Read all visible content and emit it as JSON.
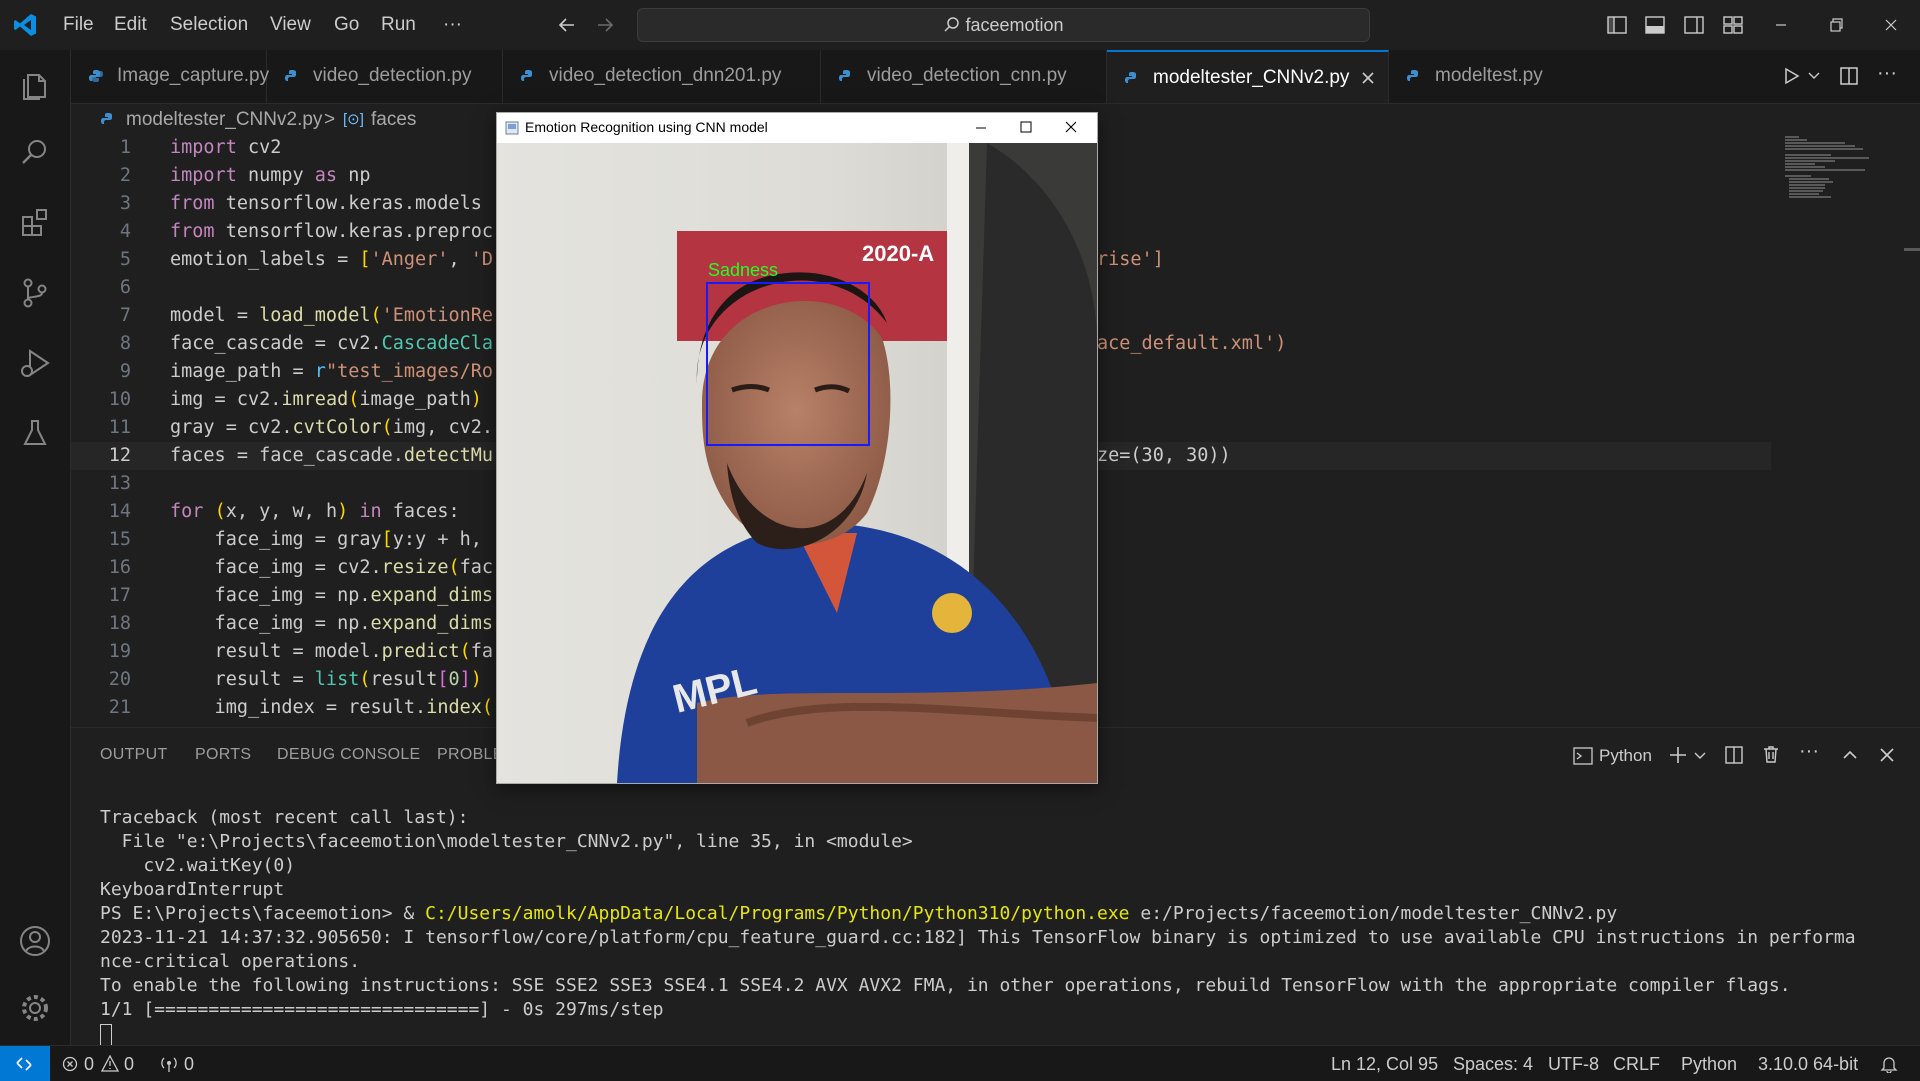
{
  "menu": [
    "File",
    "Edit",
    "Selection",
    "View",
    "Go",
    "Run",
    "···"
  ],
  "search": {
    "label": "faceemotion"
  },
  "tabs": [
    {
      "label": "Image_capture.py"
    },
    {
      "label": "video_detection.py"
    },
    {
      "label": "video_detection_dnn201.py"
    },
    {
      "label": "video_detection_cnn.py"
    },
    {
      "label": "modeltester_CNNv2.py",
      "active": true
    },
    {
      "label": "modeltest.py"
    }
  ],
  "breadcrumb": {
    "file": "modeltester_CNNv2.py",
    "separator": ">",
    "symbol": "faces"
  },
  "code_lines": [
    {
      "n": "1",
      "t": "import cv2"
    },
    {
      "n": "2",
      "t": "import numpy as np"
    },
    {
      "n": "3",
      "t": "from tensorflow.keras.models"
    },
    {
      "n": "4",
      "t": "from tensorflow.keras.preproc"
    },
    {
      "n": "5",
      "t": "emotion_labels = ['Anger', 'D"
    },
    {
      "n": "6",
      "t": ""
    },
    {
      "n": "7",
      "t": "model = load_model('EmotionRe"
    },
    {
      "n": "8",
      "t": "face_cascade = cv2.CascadeCla"
    },
    {
      "n": "9",
      "t": "image_path = r\"test_images/Ro"
    },
    {
      "n": "10",
      "t": "img = cv2.imread(image_path)"
    },
    {
      "n": "11",
      "t": "gray = cv2.cvtColor(img, cv2."
    },
    {
      "n": "12",
      "t": "faces = face_cascade.detectMu"
    },
    {
      "n": "13",
      "t": ""
    },
    {
      "n": "14",
      "t": "for (x, y, w, h) in faces:"
    },
    {
      "n": "15",
      "t": "    face_img = gray[y:y + h,"
    },
    {
      "n": "16",
      "t": "    face_img = cv2.resize(fac"
    },
    {
      "n": "17",
      "t": "    face_img = np.expand_dims"
    },
    {
      "n": "18",
      "t": "    face_img = np.expand_dims"
    },
    {
      "n": "19",
      "t": "    result = model.predict(fa"
    },
    {
      "n": "20",
      "t": "    result = list(result[0])"
    },
    {
      "n": "21",
      "t": "    img_index = result.index("
    }
  ],
  "code_right": {
    "line5": "rise']",
    "line8": "ace_default.xml')",
    "line12": "ze=(30, 30))"
  },
  "panel_tabs": [
    "OUTPUT",
    "PORTS",
    "DEBUG CONSOLE",
    "PROBLE"
  ],
  "terminal_profile": "Python",
  "terminal_lines": [
    "Traceback (most recent call last):",
    "  File \"e:\\Projects\\faceemotion\\modeltester_CNNv2.py\", line 35, in <module>",
    "    cv2.waitKey(0)",
    "KeyboardInterrupt",
    "2023-11-21 14:37:32.905650: I tensorflow/core/platform/cpu_feature_guard.cc:182] This TensorFlow binary is optimized to use available CPU instructions in performa",
    "nce-critical operations.",
    "To enable the following instructions: SSE SSE2 SSE3 SSE4.1 SSE4.2 AVX AVX2 FMA, in other operations, rebuild TensorFlow with the appropriate compiler flags.",
    "1/1 [==============================] - 0s 297ms/step"
  ],
  "terminal_cmd": {
    "prompt": "PS E:\\Projects\\faceemotion> & ",
    "exe": "C:/Users/amolk/AppData/Local/Programs/Python/Python310/python.exe",
    "arg": " e:/Projects/faceemotion/modeltester_CNNv2.py"
  },
  "status": {
    "errors": "0",
    "warnings": "0",
    "ports": "0",
    "position": "Ln 12, Col 95",
    "spaces": "Spaces: 4",
    "encoding": "UTF-8",
    "eol": "CRLF",
    "language": "Python",
    "interpreter": "3.10.0 64-bit"
  },
  "cv_window": {
    "title": "Emotion Recognition using CNN model",
    "detection_label": "Sadness",
    "box_color": "#1a1aff",
    "label_color": "#22ff22",
    "jersey_text": "MPL",
    "bg_sign": "2020-A"
  },
  "colors": {
    "accent": "#0078d4",
    "keyword": "#c586c0",
    "string": "#ce9178",
    "function": "#dcdcaa"
  }
}
